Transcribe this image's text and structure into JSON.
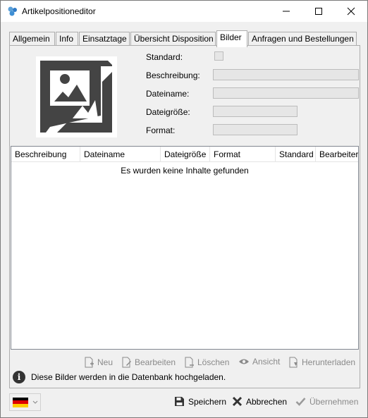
{
  "window": {
    "title": "Artikelpositioneditor"
  },
  "tabs": [
    {
      "label": "Allgemein"
    },
    {
      "label": "Info"
    },
    {
      "label": "Einsatztage"
    },
    {
      "label": "Übersicht Disposition"
    },
    {
      "label": "Bilder"
    },
    {
      "label": "Anfragen und Bestellungen"
    }
  ],
  "form": {
    "standard_label": "Standard:",
    "beschreibung_label": "Beschreibung:",
    "dateiname_label": "Dateiname:",
    "dateigroesse_label": "Dateigröße:",
    "format_label": "Format:"
  },
  "grid": {
    "columns": [
      "Beschreibung",
      "Dateiname",
      "Dateigröße",
      "Format",
      "Standard",
      "Bearbeiter"
    ],
    "empty_text": "Es wurden keine Inhalte gefunden"
  },
  "actions": {
    "neu": "Neu",
    "bearbeiten": "Bearbeiten",
    "loeschen": "Löschen",
    "ansicht": "Ansicht",
    "herunterladen": "Herunterladen"
  },
  "info_text": "Diese Bilder werden in die Datenbank hochgeladen.",
  "buttons": {
    "speichern": "Speichern",
    "abbrechen": "Abbrechen",
    "uebernehmen": "Übernehmen"
  },
  "colors": {
    "disabled": "#8a8a8a",
    "accent": "#2f7ac6"
  },
  "language": {
    "selected": "de",
    "flag_colors": [
      "#000000",
      "#dd0000",
      "#ffce00"
    ]
  }
}
